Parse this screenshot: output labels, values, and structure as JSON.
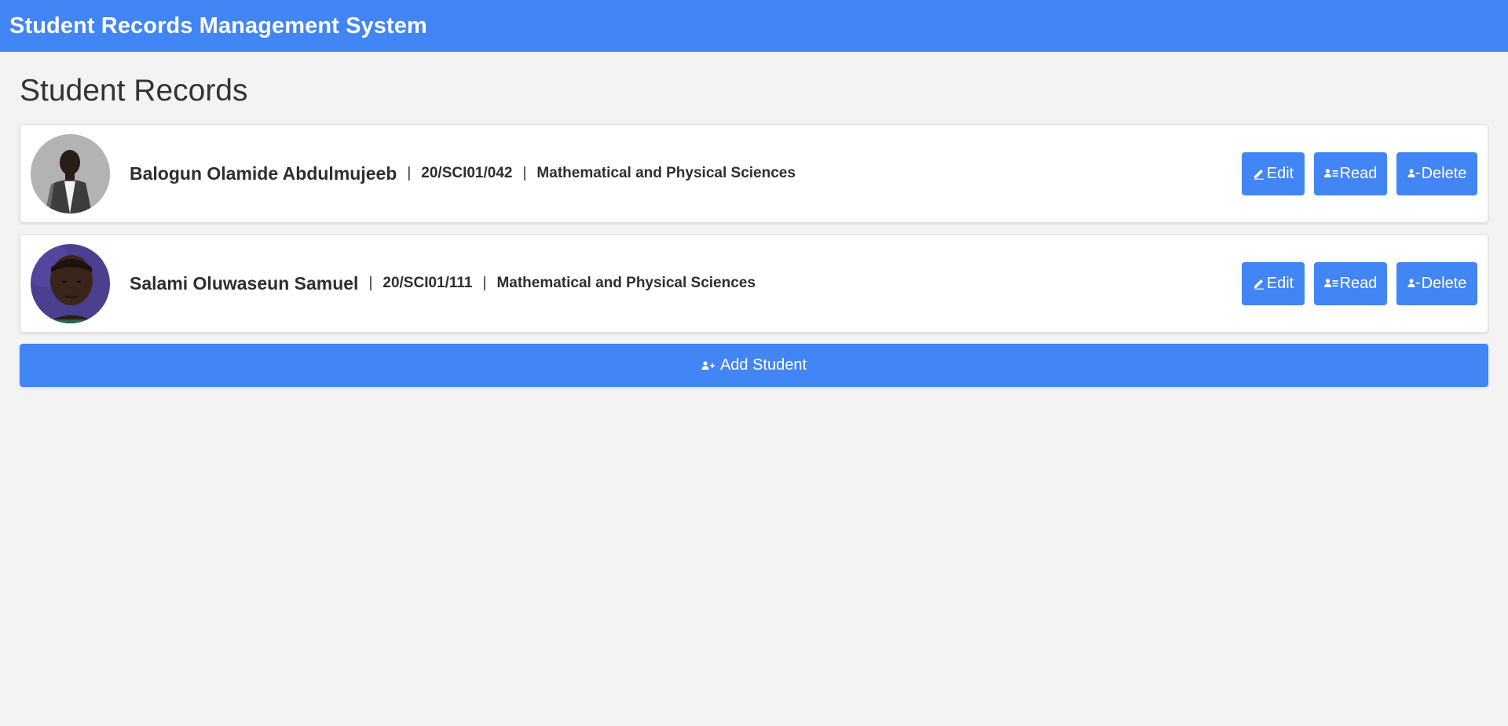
{
  "header": {
    "title": "Student Records Management System"
  },
  "main": {
    "page_title": "Student Records",
    "students": [
      {
        "name": "Balogun Olamide Abdulmujeeb",
        "matric_no": "20/SCI01/042",
        "faculty": "Mathematical and Physical Sciences"
      },
      {
        "name": "Salami Oluwaseun Samuel",
        "matric_no": "20/SCI01/111",
        "faculty": "Mathematical and Physical Sciences"
      }
    ],
    "separator": "|",
    "actions": {
      "edit_label": "Edit",
      "read_label": "Read",
      "delete_label": "Delete"
    },
    "add_button_label": "Add Student"
  },
  "icons": {
    "edit": "pencil-icon",
    "read": "user-id-card-icon",
    "delete": "user-minus-icon",
    "add": "user-plus-icon"
  },
  "colors": {
    "accent": "#4285f4",
    "background": "#f3f3f3",
    "card": "#ffffff",
    "text": "#333333"
  }
}
